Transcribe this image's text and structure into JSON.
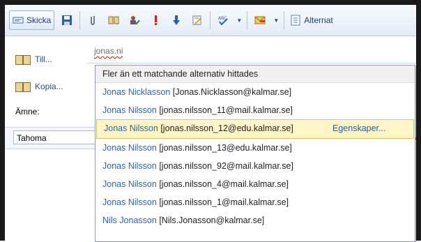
{
  "toolbar": {
    "send_label": "Skicka",
    "alternatives_label": "Alternat"
  },
  "form": {
    "to_label": "Till...",
    "cc_label": "Kopia...",
    "subject_label": "Ämne:",
    "to_value": "jonas.ni",
    "font_value": "Tahoma"
  },
  "suggestions": {
    "header": "Fler än ett matchande alternativ hittades",
    "properties_label": "Egenskaper...",
    "items": [
      {
        "name": "Jonas Nicklasson",
        "email": "[Jonas.Nicklasson@kalmar.se]"
      },
      {
        "name": "Jonas Nilsson",
        "email": "[jonas.nilsson_11@mail.kalmar.se]"
      },
      {
        "name": "Jonas Nilsson",
        "email": "[jonas.nilsson_12@edu.kalmar.se]"
      },
      {
        "name": "Jonas Nilsson",
        "email": "[jonas.nilsson_13@edu.kalmar.se]"
      },
      {
        "name": "Jonas Nilsson",
        "email": "[jonas.nilsson_92@mail.kalmar.se]"
      },
      {
        "name": "Jonas Nilsson",
        "email": "[jonas.nilsson_4@mail.kalmar.se]"
      },
      {
        "name": "Jonas Nilsson",
        "email": "[jonas.nilsson_1@mail.kalmar.se]"
      },
      {
        "name": "Nils Jonasson",
        "email": "[Nils.Jonasson@kalmar.se]"
      }
    ]
  }
}
